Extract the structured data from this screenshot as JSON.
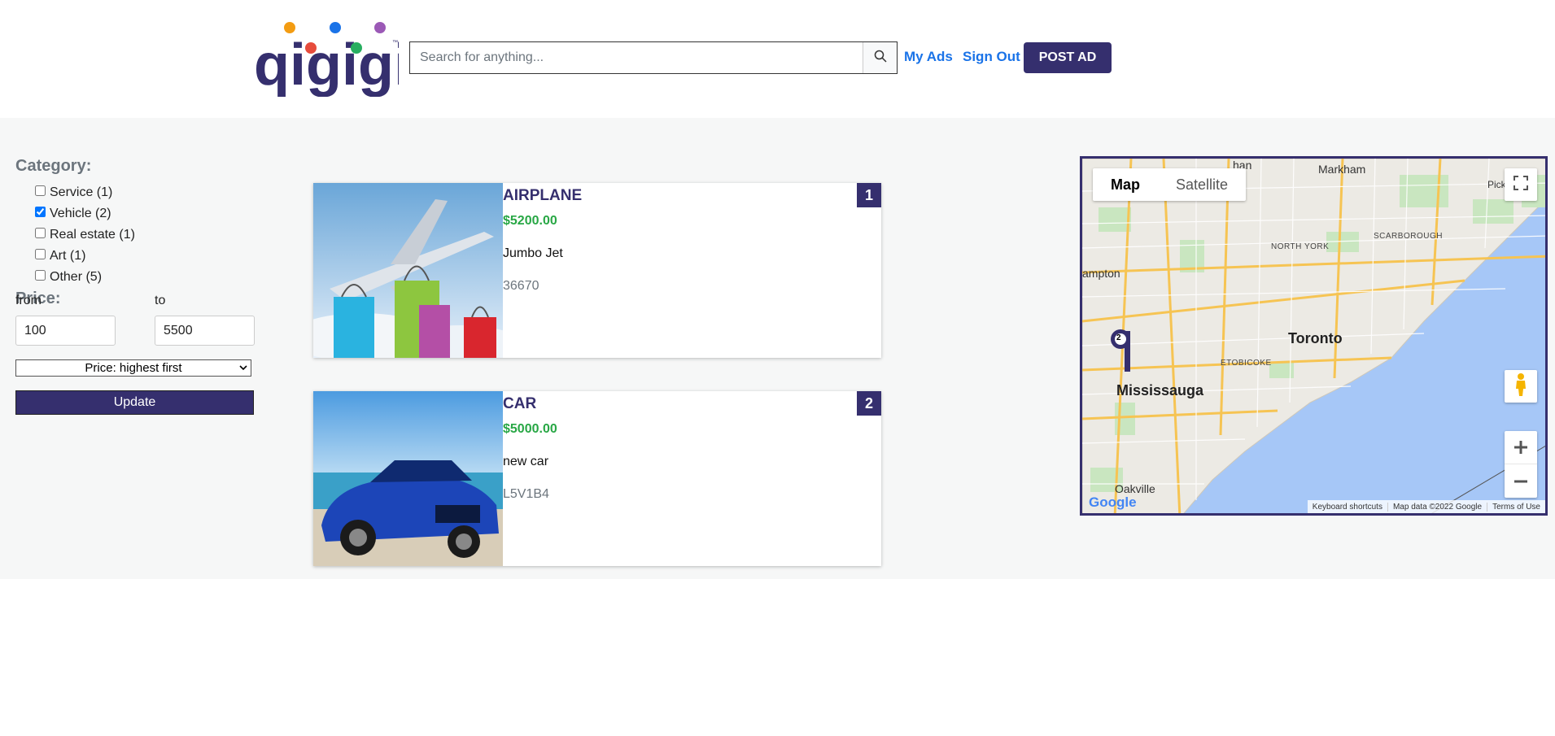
{
  "header": {
    "logo_text": "qigigi",
    "search_placeholder": "Search for anything...",
    "my_ads": "My Ads",
    "sign_out": "Sign Out",
    "post_ad": "POST AD"
  },
  "filters": {
    "category_heading": "Category:",
    "categories": [
      {
        "label": "Service (1)",
        "checked": false
      },
      {
        "label": "Vehicle (2)",
        "checked": true
      },
      {
        "label": "Real estate (1)",
        "checked": false
      },
      {
        "label": "Art (1)",
        "checked": false
      },
      {
        "label": "Other (5)",
        "checked": false
      }
    ],
    "price_heading": "Price:",
    "from_label": "from",
    "to_label": "to",
    "from_value": "100",
    "to_value": "5500",
    "sort_selected": "Price: highest first",
    "update_label": "Update"
  },
  "listings": [
    {
      "number": "1",
      "title": "AIRPLANE",
      "price": "$5200.00",
      "description": "Jumbo Jet",
      "location": "36670"
    },
    {
      "number": "2",
      "title": "CAR",
      "price": "$5000.00",
      "description": "new car",
      "location": "L5V1B4"
    }
  ],
  "map": {
    "tab_map": "Map",
    "tab_satellite": "Satellite",
    "cities": {
      "markham": "Markham",
      "toronto": "Toronto",
      "mississauga": "Mississauga",
      "oakville": "Oakville",
      "brampton": "ampton",
      "pickering": "Pickerin",
      "vaughan": "han"
    },
    "districts": {
      "north_york": "NORTH YORK",
      "scarborough": "SCARBOROUGH",
      "etobicoke": "ETOBICOKE"
    },
    "marker_label": "2",
    "footer": {
      "shortcuts": "Keyboard shortcuts",
      "map_data": "Map data ©2022 Google",
      "terms": "Terms of Use"
    },
    "google": "Google"
  }
}
